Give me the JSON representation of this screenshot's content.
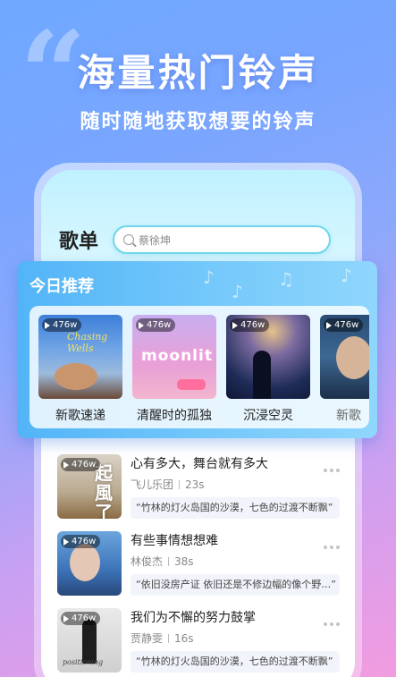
{
  "banner": {
    "headline": "海量热门铃声",
    "subline": "随时随地获取想要的铃声"
  },
  "header": {
    "title": "歌单"
  },
  "search": {
    "placeholder": "蔡徐坤"
  },
  "recommend": {
    "title": "今日推荐",
    "items": [
      {
        "plays": "476w",
        "name": "新歌速递",
        "cover_text": "Chasing Wells"
      },
      {
        "plays": "476w",
        "name": "清醒时的孤独",
        "cover_text": "moonlit"
      },
      {
        "plays": "476w",
        "name": "沉浸空灵"
      },
      {
        "plays": "476w",
        "name": "新歌"
      }
    ]
  },
  "songs": [
    {
      "plays": "476w",
      "title": "心有多大，舞台就有多大",
      "artist": "飞儿乐团",
      "duration": "23s",
      "lyric": "“竹林的灯火岛国的沙漠，七色的过渡不断飘”",
      "cover_text": "起風了"
    },
    {
      "plays": "476w",
      "title": "有些事情想想难",
      "artist": "林俊杰",
      "duration": "38s",
      "lyric": "“依旧没房产证 依旧还是不修边幅的像个野…”"
    },
    {
      "plays": "476w",
      "title": "我们为不懈的努力鼓掌",
      "artist": "贾静雯",
      "duration": "16s",
      "lyric": "“竹林的灯火岛国的沙漠，七色的过渡不断飘”"
    }
  ]
}
